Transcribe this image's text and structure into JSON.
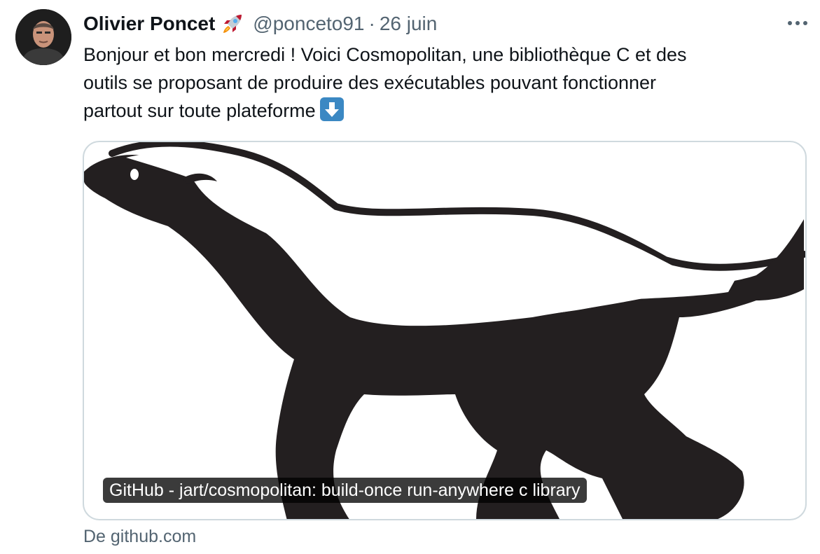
{
  "tweet": {
    "author_name": "Olivier Poncet",
    "author_emoji_icon": "rocket-icon",
    "handle": "@ponceto91",
    "separator": "·",
    "date": "26 juin",
    "text_line1": "Bonjour et bon mercredi ! Voici Cosmopolitan, une bibliothèque C et des",
    "text_line2": "outils se proposant de produire des exécutables pouvant fonctionner",
    "text_line3": "partout sur toute plateforme",
    "text_emoji_icon": "down-arrow-emoji-icon"
  },
  "card": {
    "title": "GitHub - jart/cosmopolitan: build-once run-anywhere c library",
    "image_icon": "honey-badger-logo",
    "source": "De github.com"
  },
  "colors": {
    "text": "#0f1419",
    "secondary": "#536471",
    "border": "#cfd9de",
    "emoji_blue": "#3b88c3",
    "badger": "#231f20"
  }
}
